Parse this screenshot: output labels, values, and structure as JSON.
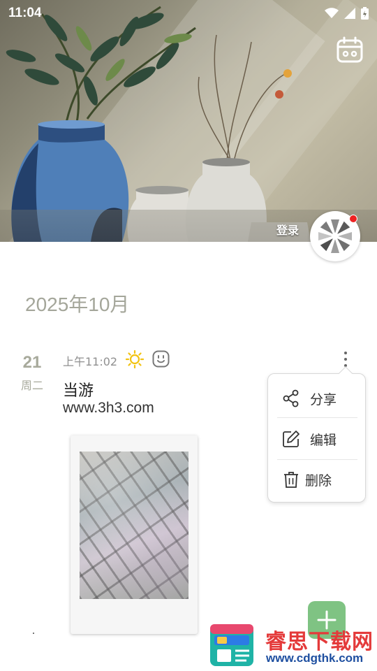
{
  "status_bar": {
    "time": "11:04"
  },
  "header": {
    "login_label": "登录"
  },
  "timeline": {
    "month": "2025年10月",
    "entry": {
      "day": "21",
      "weekday": "周二",
      "time": "上午11:02",
      "weather_icon": "sun-icon",
      "mood_icon": "smile-face-icon",
      "title": "当游",
      "url": "www.3h3.com"
    }
  },
  "context_menu": {
    "items": [
      {
        "icon": "share-icon",
        "label": "分享"
      },
      {
        "icon": "edit-icon",
        "label": "编辑"
      },
      {
        "icon": "trash-icon",
        "label": "删除"
      }
    ]
  },
  "fab": {
    "icon": "plus-icon"
  },
  "watermark": {
    "title": "睿思下载网",
    "url": "www.cdgthk.com"
  },
  "colors": {
    "accent_green": "#7fc383",
    "muted_text": "#a4a69a",
    "sun_yellow": "#f2c311",
    "notification_red": "#ee2222",
    "watermark_red": "#e43a3a",
    "watermark_blue": "#1e4fa0"
  }
}
